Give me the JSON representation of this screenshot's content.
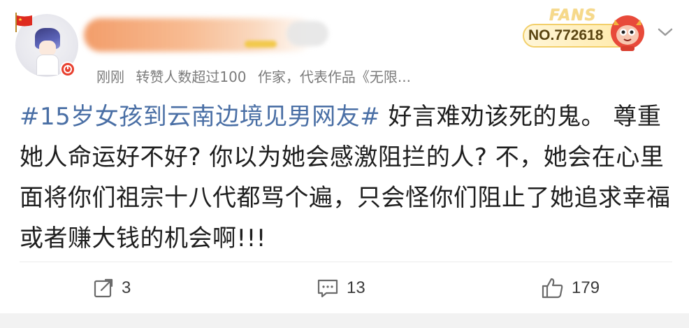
{
  "header": {
    "meta_time": "刚刚",
    "meta_likes_note": "转赞人数超过100",
    "meta_bio": "作家，代表作品《无限..."
  },
  "fans_badge": {
    "word": "FANS",
    "number": "NO.772618"
  },
  "post": {
    "hashtag": "#15岁女孩到云南边境见男网友#",
    "body": "  好言难劝该死的鬼。 尊重她人命运好不好? 你以为她会感激阻拦的人? 不，她会在心里面将你们祖宗十八代都骂个遍，只会怪你们阻止了她追求幸福或者赚大钱的机会啊!!!"
  },
  "actions": {
    "reposts": "3",
    "comments": "13",
    "likes": "179"
  },
  "colors": {
    "hashtag": "#4a6fa5",
    "meta": "#7b7b7b",
    "verified": "#e8402f",
    "fans_gold": "#f2cf6a"
  },
  "icons": [
    "china-flag-icon",
    "verified-icon",
    "fans-mascot-icon",
    "chevron-down-icon",
    "repost-icon",
    "comment-icon",
    "like-icon"
  ]
}
